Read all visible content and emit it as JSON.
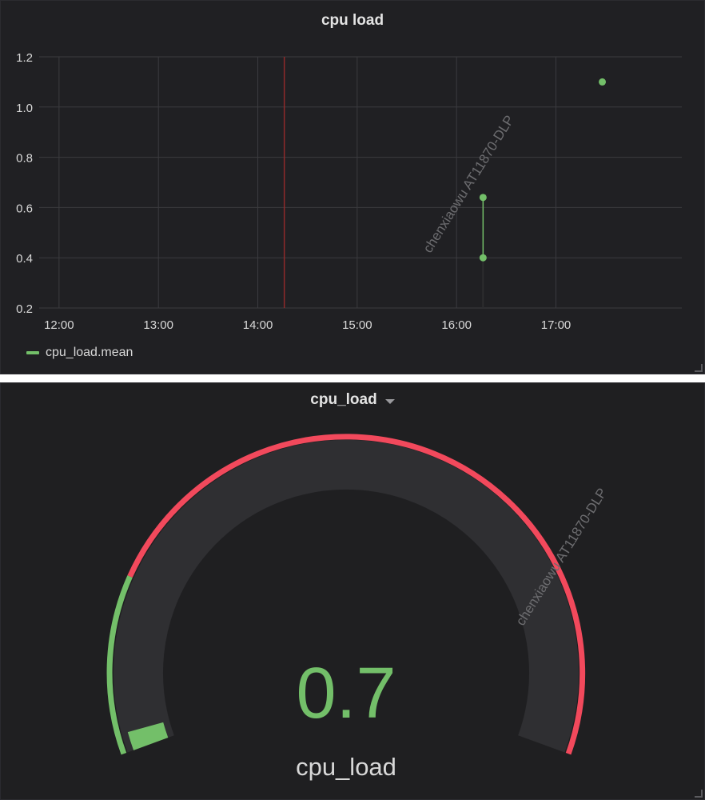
{
  "graph_panel": {
    "title": "cpu load",
    "legend_label": "cpu_load.mean",
    "watermark": "chenxiaowu   AT11870-DLP"
  },
  "gauge_panel": {
    "title": "cpu_load",
    "value": "0.7",
    "value_label": "cpu_load",
    "watermark": "chenxiaowu   AT11870-DLP",
    "colors": {
      "ok": "#73bf69",
      "critical": "#f2495c",
      "track": "#2f2f32"
    },
    "threshold_fraction": 0.2,
    "value_fraction": 0.0
  },
  "chart_data": {
    "type": "line",
    "title": "cpu load",
    "xlabel": "",
    "ylabel": "",
    "x_ticks": [
      "12:00",
      "13:00",
      "14:00",
      "15:00",
      "16:00",
      "17:00"
    ],
    "y_ticks": [
      "0.2",
      "0.4",
      "0.6",
      "0.8",
      "1.0",
      "1.2"
    ],
    "ylim": [
      0.2,
      1.2
    ],
    "xlim": [
      "11:48",
      "18:16"
    ],
    "grid": true,
    "legend": "bottom-left",
    "annotation_time": "14:16",
    "series": [
      {
        "name": "cpu_load.mean",
        "color": "#73bf69",
        "points": [
          {
            "x": "16:16",
            "y": 0.64
          },
          {
            "x": "16:16",
            "y": 0.4
          },
          {
            "x": "17:28",
            "y": 1.1
          }
        ]
      }
    ]
  }
}
